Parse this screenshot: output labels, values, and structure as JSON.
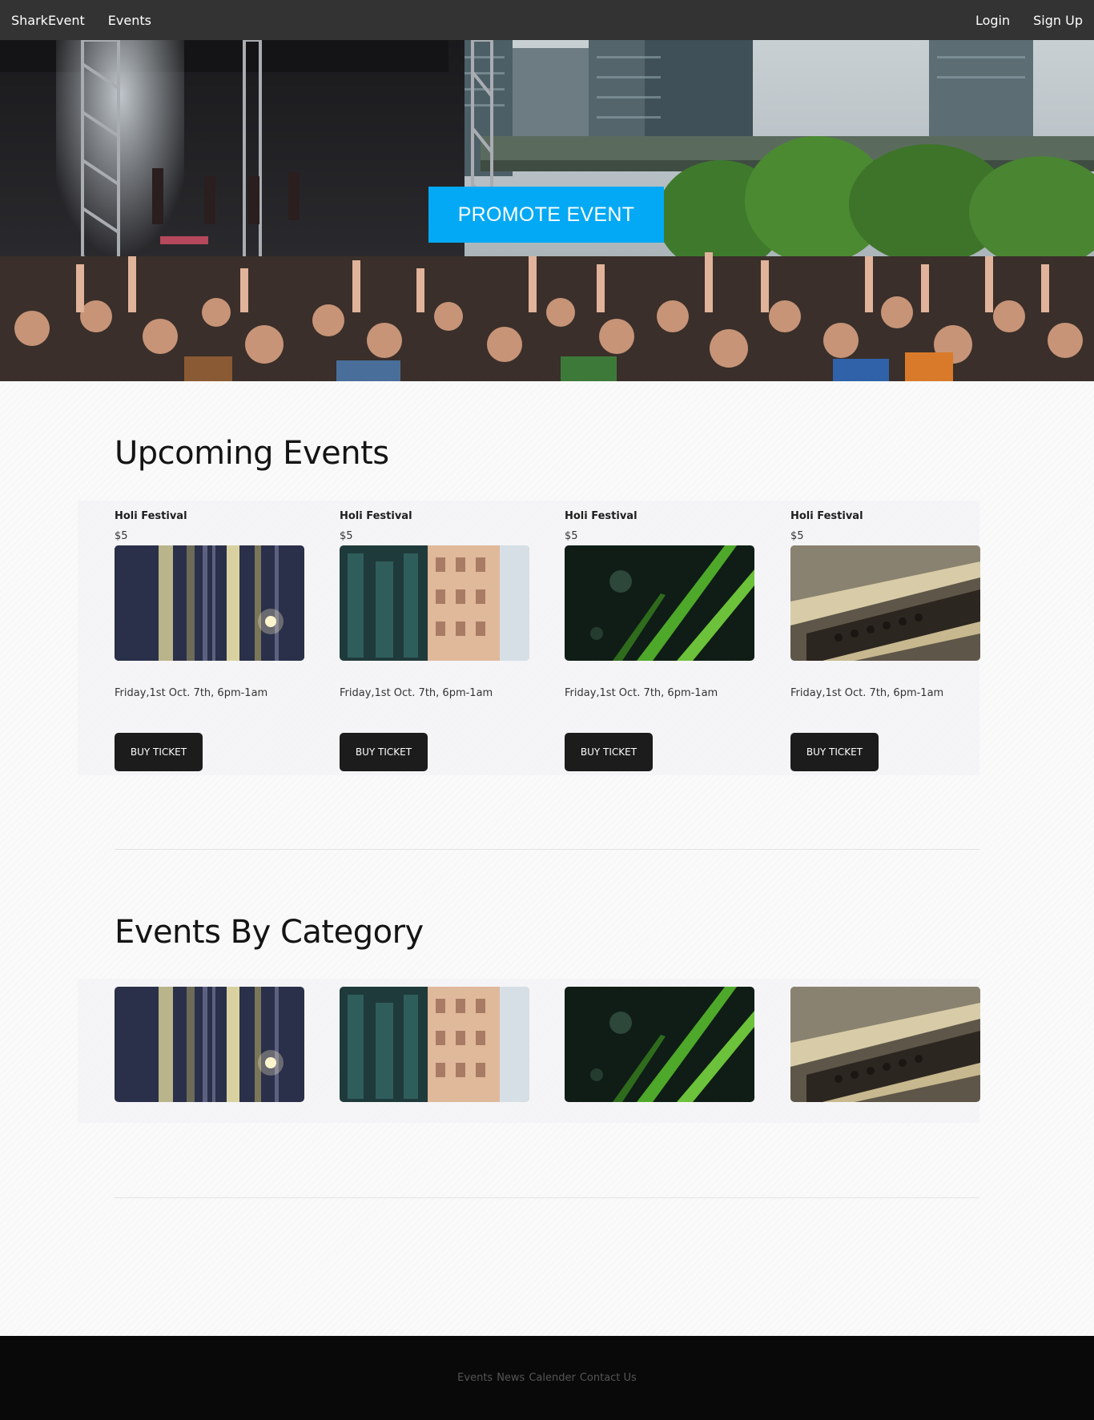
{
  "navbar": {
    "brand": "SharkEvent",
    "events": "Events",
    "login": "Login",
    "signup": "Sign Up"
  },
  "hero": {
    "promote_label": "PROMOTE EVENT",
    "accent_color": "#03a9f4"
  },
  "upcoming": {
    "title": "Upcoming Events",
    "events": [
      {
        "title": "Holi Festival",
        "price": "$5",
        "date": "Friday,1st Oct. 7th, 6pm-1am",
        "button": "BUY TICKET"
      },
      {
        "title": "Holi Festival",
        "price": "$5",
        "date": "Friday,1st Oct. 7th, 6pm-1am",
        "button": "BUY TICKET"
      },
      {
        "title": "Holi Festival",
        "price": "$5",
        "date": "Friday,1st Oct. 7th, 6pm-1am",
        "button": "BUY TICKET"
      },
      {
        "title": "Holi Festival",
        "price": "$5",
        "date": "Friday,1st Oct. 7th, 6pm-1am",
        "button": "BUY TICKET"
      }
    ]
  },
  "categories": {
    "title": "Events By Category"
  },
  "footer": {
    "links": [
      "Events",
      "News",
      "Calender",
      "Contact Us"
    ]
  }
}
